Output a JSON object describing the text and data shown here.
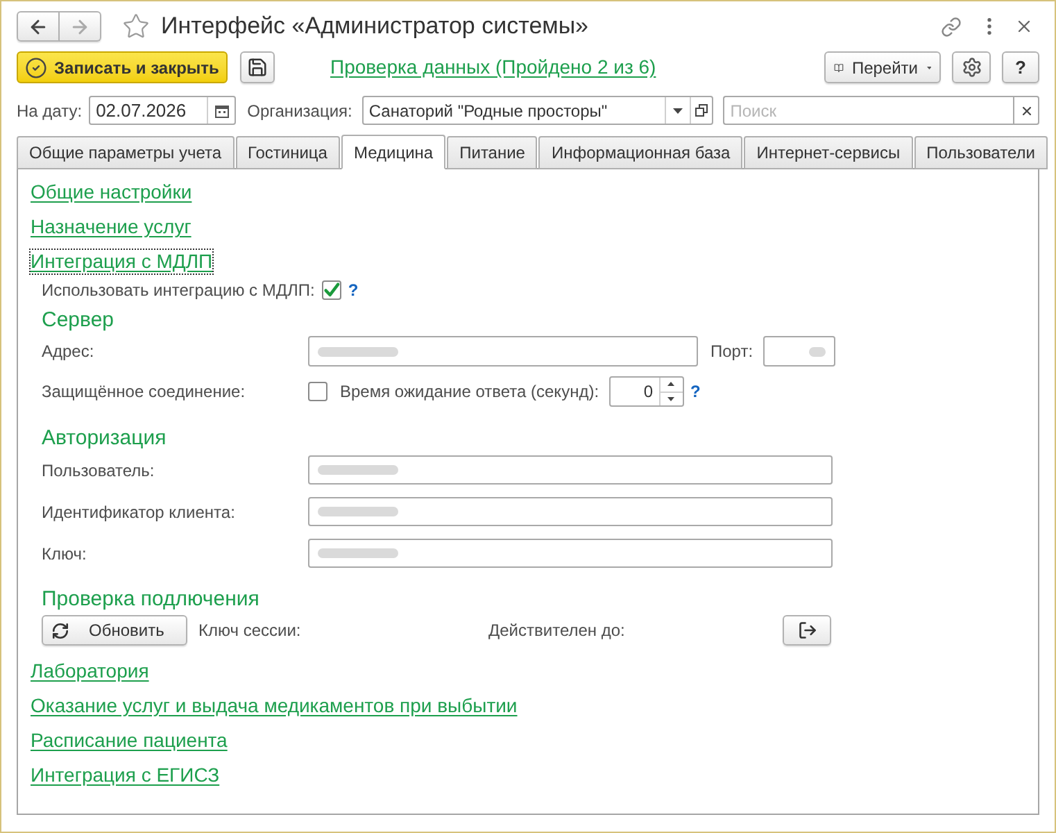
{
  "window": {
    "title": "Интерфейс «Администратор системы»"
  },
  "command_bar": {
    "save_close_button": "Записать и закрыть",
    "check_link": "Проверка данных (Пройдено 2 из 6)",
    "goto_button": "Перейти",
    "help_button": "?"
  },
  "filters": {
    "date": {
      "label": "На дату:",
      "value": "02.07.2026"
    },
    "organization": {
      "label": "Организация:",
      "value": "Санаторий \"Родные просторы\""
    },
    "search": {
      "placeholder": "Поиск"
    }
  },
  "tabs": [
    {
      "label": "Общие параметры учета",
      "selected": false
    },
    {
      "label": "Гостиница",
      "selected": false
    },
    {
      "label": "Медицина",
      "selected": true
    },
    {
      "label": "Питание",
      "selected": false
    },
    {
      "label": "Информационная база",
      "selected": false
    },
    {
      "label": "Интернет-сервисы",
      "selected": false
    },
    {
      "label": "Пользователи",
      "selected": false
    }
  ],
  "top_links": [
    {
      "label": "Общие настройки",
      "focused": false
    },
    {
      "label": "Назначение услуг",
      "focused": false
    },
    {
      "label": "Интеграция с МДЛП",
      "focused": true
    }
  ],
  "mdlp": {
    "use_integration": {
      "label": "Использовать интеграцию с МДЛП:",
      "checked": true,
      "help": "?"
    },
    "server": {
      "heading": "Сервер",
      "address": {
        "label": "Адрес:",
        "redacted": true
      },
      "port": {
        "label": "Порт:",
        "redacted": true
      },
      "secure": {
        "label": "Защищённое соединение:",
        "checked": false
      },
      "timeout": {
        "label": "Время ожидание ответа (секунд):",
        "value": "0",
        "help": "?"
      }
    },
    "authorization": {
      "heading": "Авторизация",
      "fields": [
        {
          "label": "Пользователь:",
          "redacted": true
        },
        {
          "label": "Идентификатор клиента:",
          "redacted": true
        },
        {
          "label": "Ключ:",
          "redacted": true
        }
      ]
    },
    "connection_check": {
      "heading": "Проверка подлючения",
      "refresh_button": "Обновить",
      "session_key_label": "Ключ сессии:",
      "valid_until_label": "Действителен до:"
    }
  },
  "bottom_links": [
    {
      "label": "Лаборатория",
      "focused": false
    },
    {
      "label": "Оказание услуг и выдача медикаментов при выбытии",
      "focused": false
    },
    {
      "label": "Расписание пациента",
      "focused": false
    },
    {
      "label": "Интеграция с ЕГИСЗ",
      "focused": false
    }
  ]
}
